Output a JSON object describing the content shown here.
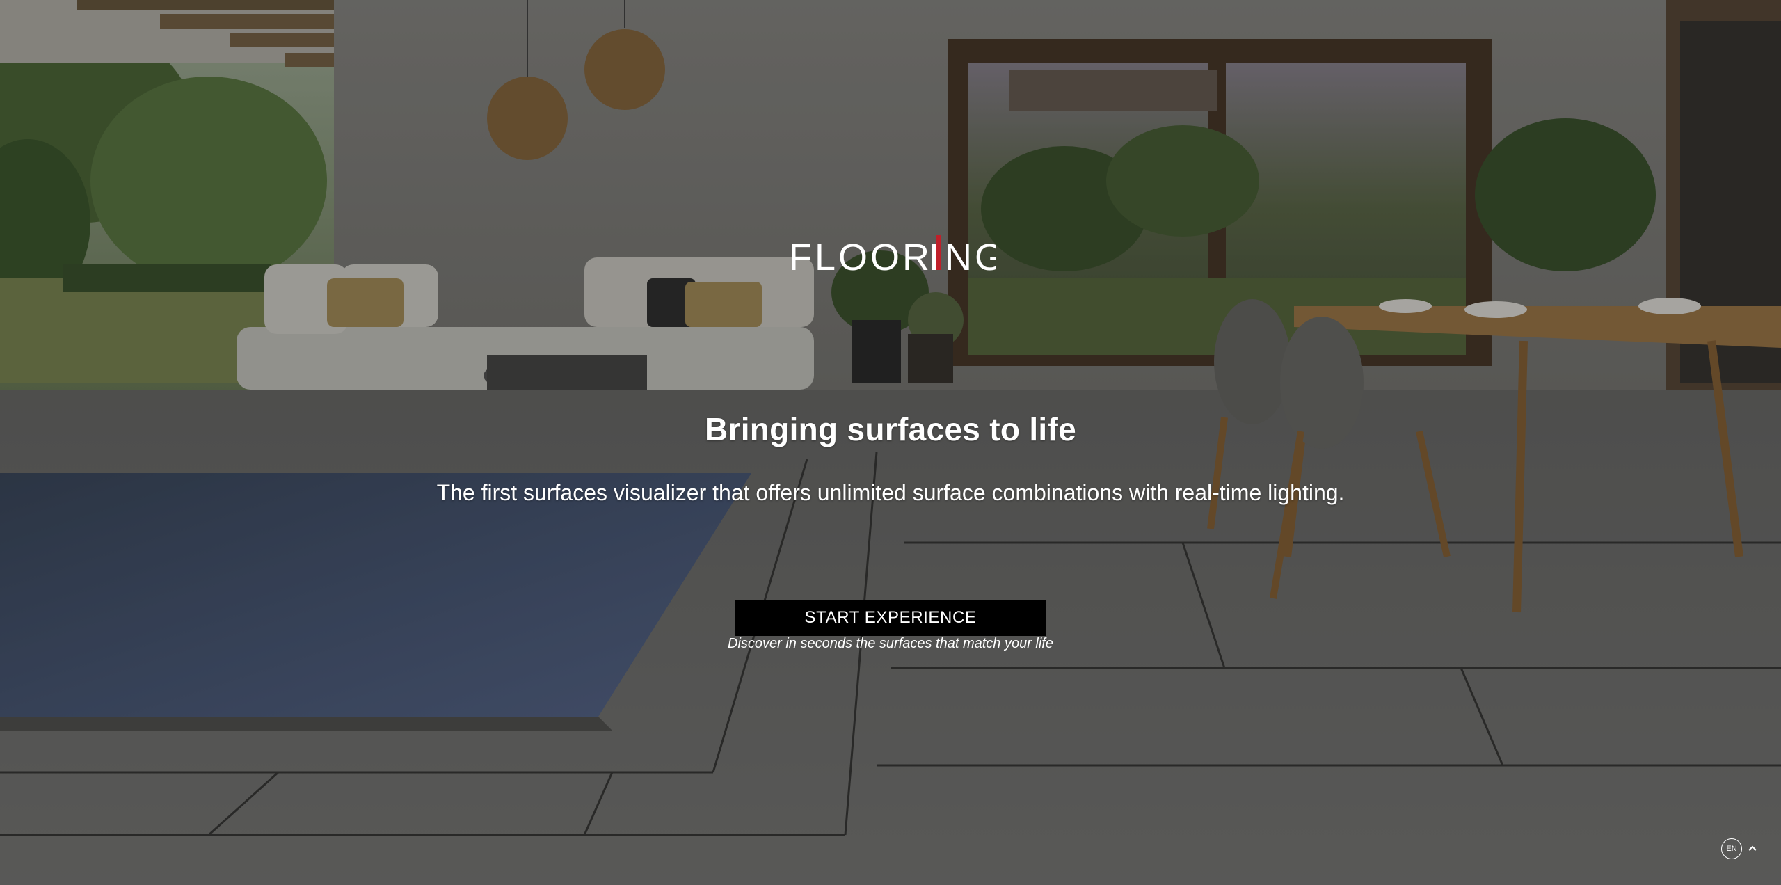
{
  "brand": {
    "logo_text": "FLOORING",
    "accent_color": "#c0202a"
  },
  "hero": {
    "headline": "Bringing surfaces to life",
    "subline": "The first surfaces visualizer that offers unlimited surface combinations with real-time lighting."
  },
  "cta": {
    "button_label": "START EXPERIENCE",
    "note": "Discover in seconds the surfaces that match your life"
  },
  "language": {
    "current": "EN",
    "icon": "chevron-up-icon"
  },
  "background": {
    "description_icon": "hero-background-image"
  }
}
